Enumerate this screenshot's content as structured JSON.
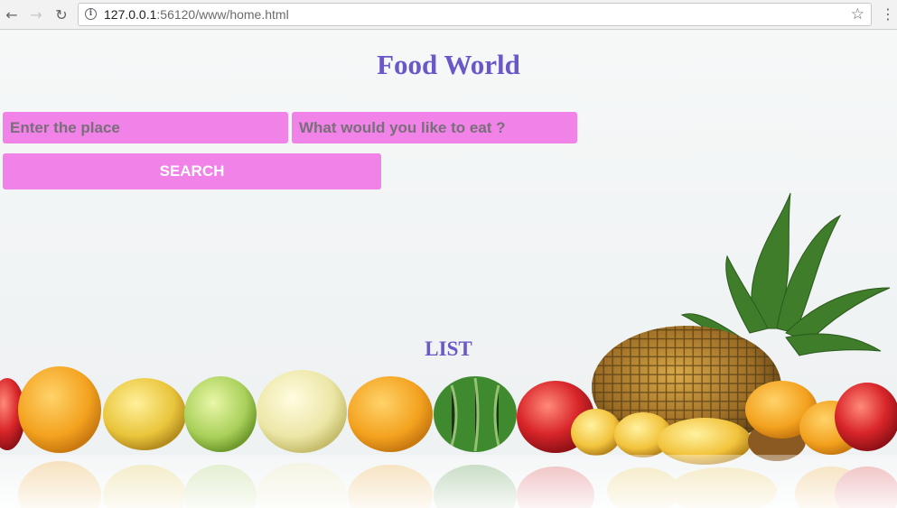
{
  "browser": {
    "url_host": "127.0.0.1",
    "url_rest": ":56120/www/home.html",
    "icons": {
      "back": "back-arrow-icon",
      "forward": "forward-arrow-icon",
      "reload": "reload-icon",
      "info": "info-icon",
      "bookmark": "star-icon",
      "menu": "menu-icon"
    }
  },
  "page": {
    "title": "Food World",
    "place_placeholder": "Enter the place",
    "food_placeholder": "What would you like to eat ?",
    "search_label": "SEARCH",
    "list_heading": "LIST"
  },
  "colors": {
    "accent": "#f082e8",
    "title": "#6a57c8",
    "placeholder": "#7a6e7a"
  }
}
